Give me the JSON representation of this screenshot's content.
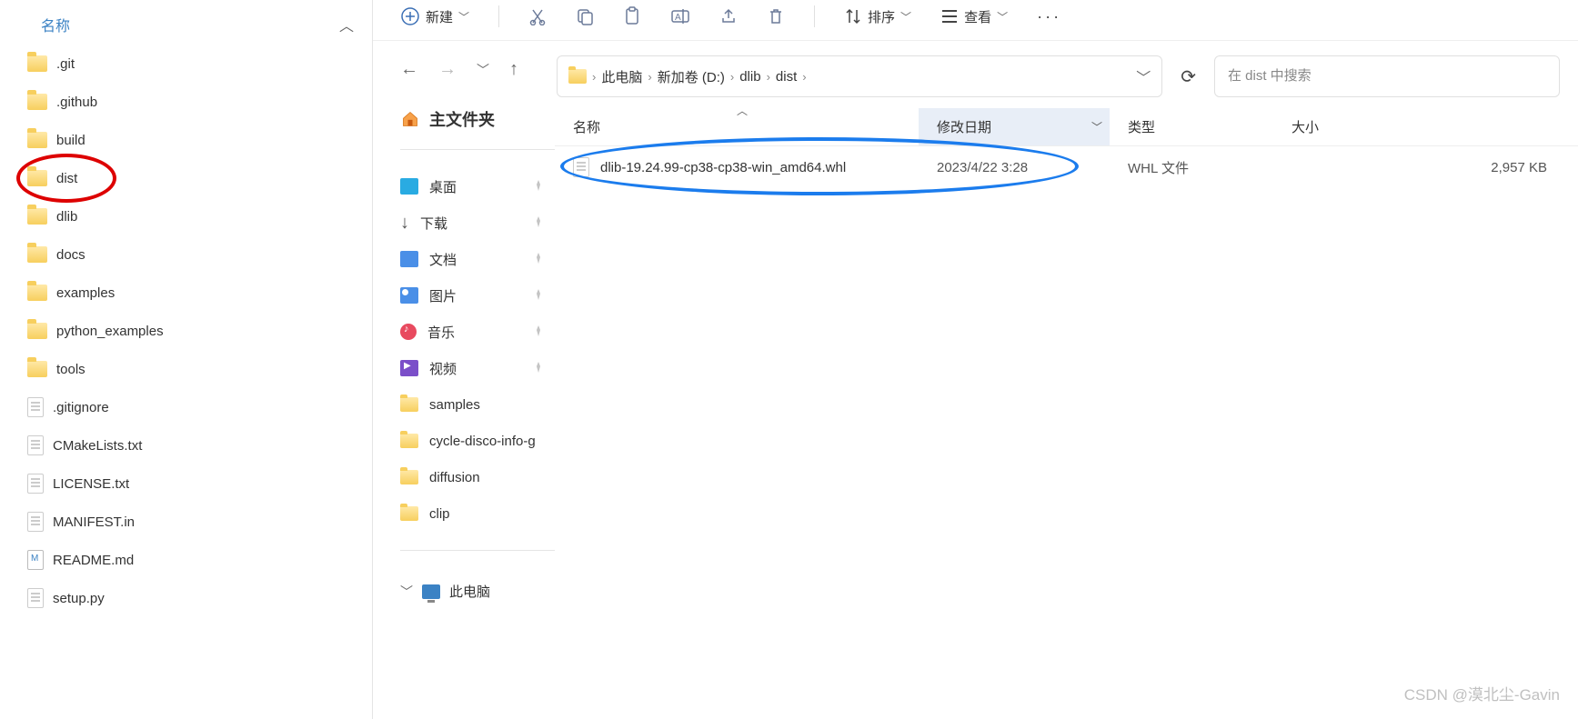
{
  "left_panel": {
    "header": "名称",
    "items": [
      {
        "type": "folder",
        "label": ".git"
      },
      {
        "type": "folder",
        "label": ".github"
      },
      {
        "type": "folder",
        "label": "build"
      },
      {
        "type": "folder",
        "label": "dist",
        "circled": true
      },
      {
        "type": "folder",
        "label": "dlib"
      },
      {
        "type": "folder",
        "label": "docs"
      },
      {
        "type": "folder",
        "label": "examples"
      },
      {
        "type": "folder",
        "label": "python_examples"
      },
      {
        "type": "folder",
        "label": "tools"
      },
      {
        "type": "file",
        "label": ".gitignore"
      },
      {
        "type": "file",
        "label": "CMakeLists.txt"
      },
      {
        "type": "file",
        "label": "LICENSE.txt"
      },
      {
        "type": "file",
        "label": "MANIFEST.in"
      },
      {
        "type": "md",
        "label": "README.md"
      },
      {
        "type": "file",
        "label": "setup.py"
      }
    ]
  },
  "toolbar": {
    "new_label": "新建",
    "sort_label": "排序",
    "view_label": "查看"
  },
  "breadcrumb": {
    "items": [
      "此电脑",
      "新加卷 (D:)",
      "dlib",
      "dist"
    ]
  },
  "search": {
    "placeholder": "在 dist 中搜索"
  },
  "nav_sidebar": {
    "home": "主文件夹",
    "pinned": [
      {
        "icon": "desk",
        "label": "桌面",
        "pin": true
      },
      {
        "icon": "dl",
        "label": "下载",
        "pin": true
      },
      {
        "icon": "doc",
        "label": "文档",
        "pin": true
      },
      {
        "icon": "pic",
        "label": "图片",
        "pin": true
      },
      {
        "icon": "music",
        "label": "音乐",
        "pin": true
      },
      {
        "icon": "video",
        "label": "视频",
        "pin": true
      },
      {
        "icon": "folder",
        "label": "samples",
        "pin": false
      },
      {
        "icon": "folder",
        "label": "cycle-disco-info-g",
        "pin": false
      },
      {
        "icon": "folder",
        "label": "diffusion",
        "pin": false
      },
      {
        "icon": "folder",
        "label": "clip",
        "pin": false
      }
    ],
    "this_pc": "此电脑"
  },
  "columns": {
    "name": "名称",
    "date": "修改日期",
    "type": "类型",
    "size": "大小"
  },
  "files": [
    {
      "name": "dlib-19.24.99-cp38-cp38-win_amd64.whl",
      "date": "2023/4/22 3:28",
      "type": "WHL 文件",
      "size": "2,957 KB",
      "circled": true
    }
  ],
  "watermark": "CSDN @漠北尘-Gavin"
}
